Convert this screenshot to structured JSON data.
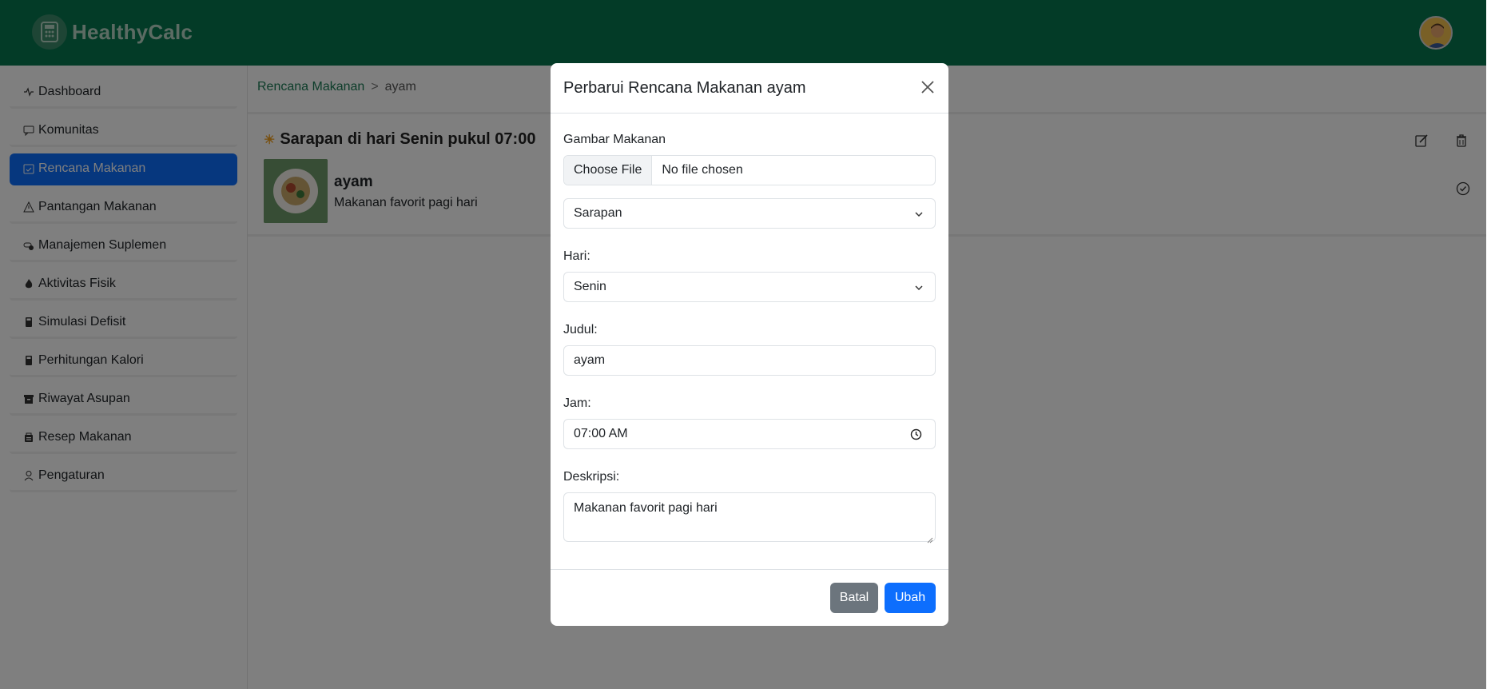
{
  "app": {
    "name": "HealthyCalc"
  },
  "sidebar": {
    "items": [
      {
        "label": "Dashboard",
        "icon": "activity-icon"
      },
      {
        "label": "Komunitas",
        "icon": "chat-icon"
      },
      {
        "label": "Rencana Makanan",
        "icon": "calendar-check-icon",
        "active": true
      },
      {
        "label": "Pantangan Makanan",
        "icon": "warning-icon"
      },
      {
        "label": "Manajemen Suplemen",
        "icon": "capsule-icon"
      },
      {
        "label": "Aktivitas Fisik",
        "icon": "fire-icon"
      },
      {
        "label": "Simulasi Defisit",
        "icon": "calculator-icon"
      },
      {
        "label": "Perhitungan Kalori",
        "icon": "calculator-icon"
      },
      {
        "label": "Riwayat Asupan",
        "icon": "archive-icon"
      },
      {
        "label": "Resep Makanan",
        "icon": "lunchbox-icon"
      },
      {
        "label": "Pengaturan",
        "icon": "person-icon"
      }
    ]
  },
  "breadcrumb": {
    "root": "Rencana Makanan",
    "separator": ">",
    "current": "ayam"
  },
  "meal_card": {
    "heading": "Sarapan di hari Senin pukul 07:00",
    "title": "ayam",
    "description": "Makanan favorit pagi hari"
  },
  "modal": {
    "title": "Perbarui Rencana Makanan ayam",
    "image_label": "Gambar Makanan",
    "file_button": "Choose File",
    "file_status": "No file chosen",
    "meal_type": "Sarapan",
    "day_label": "Hari:",
    "day_value": "Senin",
    "title_label": "Judul:",
    "title_value": "ayam",
    "time_label": "Jam:",
    "time_value": "07:00 AM",
    "desc_label": "Deskripsi:",
    "desc_value": "Makanan favorit pagi hari",
    "cancel_label": "Batal",
    "save_label": "Ubah"
  },
  "colors": {
    "header": "#06774f",
    "primary": "#0d6efd",
    "secondary": "#6c757d"
  }
}
